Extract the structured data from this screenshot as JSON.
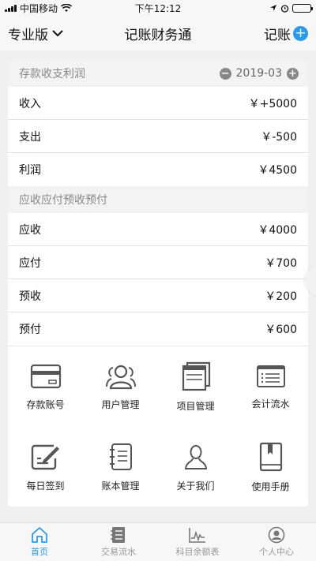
{
  "status_bar": {
    "carrier": "中国移动",
    "time": "下午12:12"
  },
  "nav": {
    "edition": "专业版",
    "title": "记账财务通",
    "record_label": "记账"
  },
  "profit_section": {
    "title": "存款收支利润",
    "month": "2019-03",
    "rows": [
      {
        "label": "收入",
        "value": "￥+5000"
      },
      {
        "label": "支出",
        "value": "￥-500"
      },
      {
        "label": "利润",
        "value": "￥4500"
      }
    ]
  },
  "receivable_section": {
    "title": "应收应付预收预付",
    "rows": [
      {
        "label": "应收",
        "value": "￥4000"
      },
      {
        "label": "应付",
        "value": "￥700"
      },
      {
        "label": "预收",
        "value": "￥200"
      },
      {
        "label": "预付",
        "value": "￥600"
      }
    ]
  },
  "features": [
    {
      "label": "存款账号",
      "icon": "card-icon"
    },
    {
      "label": "用户管理",
      "icon": "users-icon"
    },
    {
      "label": "项目管理",
      "icon": "project-icon"
    },
    {
      "label": "会计流水",
      "icon": "ledger-list-icon"
    },
    {
      "label": "每日签到",
      "icon": "signin-icon"
    },
    {
      "label": "账本管理",
      "icon": "notebook-icon"
    },
    {
      "label": "关于我们",
      "icon": "person-icon"
    },
    {
      "label": "使用手册",
      "icon": "manual-icon"
    }
  ],
  "tabs": [
    {
      "label": "首页",
      "icon": "home-icon",
      "active": true
    },
    {
      "label": "交易流水",
      "icon": "transactions-icon",
      "active": false
    },
    {
      "label": "科目余额表",
      "icon": "balance-chart-icon",
      "active": false
    },
    {
      "label": "个人中心",
      "icon": "profile-icon",
      "active": false
    }
  ],
  "colors": {
    "accent": "#2a9af0",
    "background": "#f0f0f2",
    "section_header": "#f3f3f5"
  }
}
